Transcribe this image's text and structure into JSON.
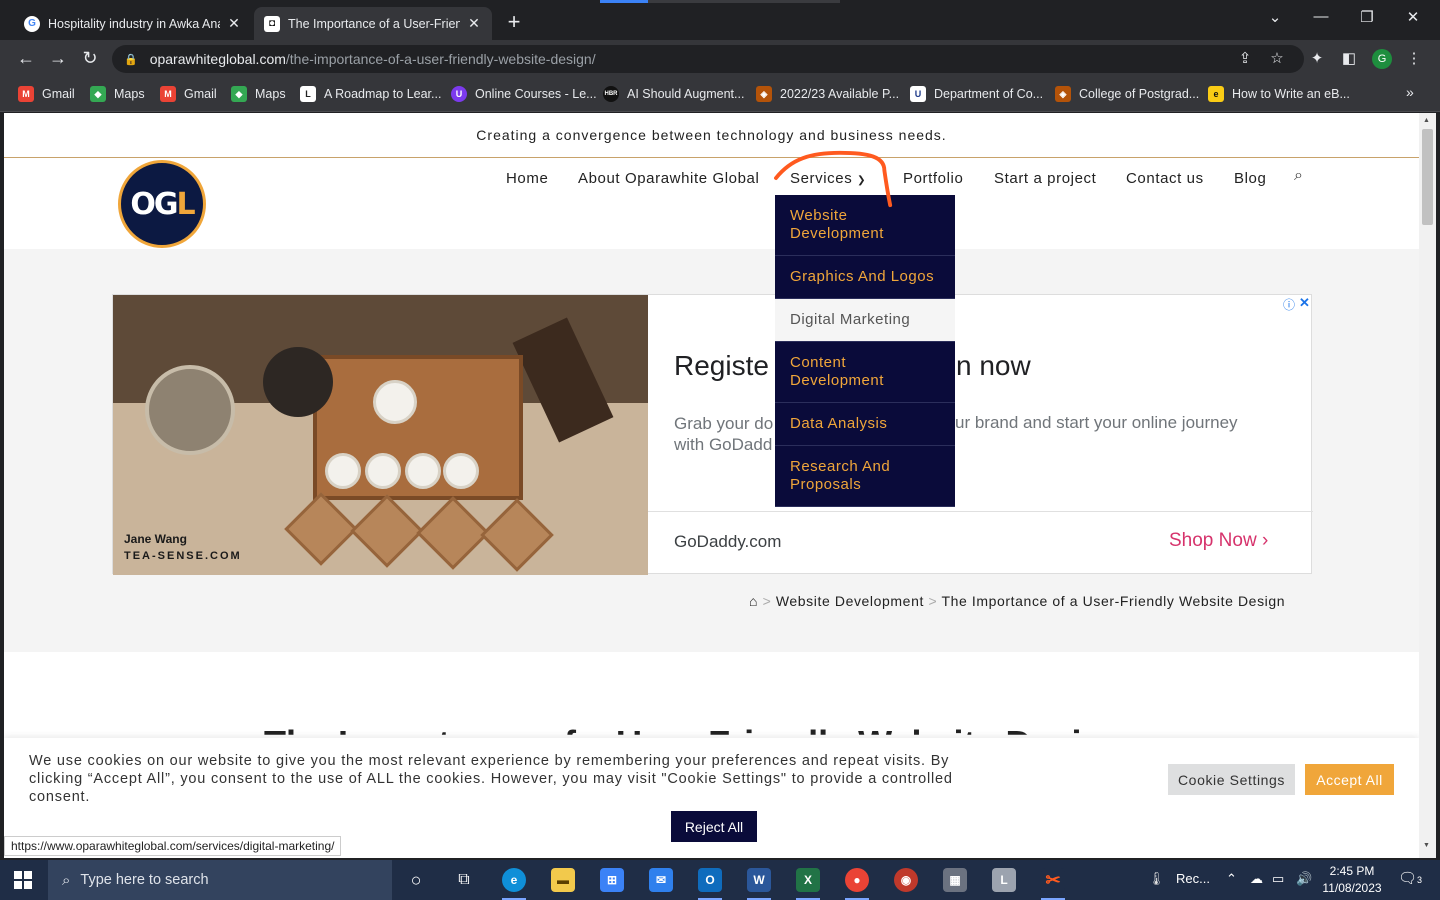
{
  "browser": {
    "tabs": [
      {
        "title": "Hospitality industry in Awka Anambra",
        "favicon": "google-icon"
      },
      {
        "title": "The Importance of a User-Friendly Website Design",
        "favicon": "site-icon"
      }
    ],
    "url_host": "oparawhiteglobal.com",
    "url_path": "/the-importance-of-a-user-friendly-website-design/",
    "bookmarks": [
      "Gmail",
      "Maps",
      "Gmail",
      "Maps",
      "A Roadmap to Lear...",
      "Online Courses - Le...",
      "AI Should Augment...",
      "2022/23 Available P...",
      "Department of Co...",
      "College of Postgrad...",
      "How to Write an eB..."
    ],
    "profile_initial": "G"
  },
  "site": {
    "tagline": "Creating a convergence between technology and business needs.",
    "logo_text": "OGL",
    "nav": [
      "Home",
      "About Oparawhite Global",
      "Services",
      "Portfolio",
      "Start a project",
      "Contact us",
      "Blog"
    ],
    "services_menu": [
      "Website Development",
      "Graphics And Logos",
      "Digital Marketing",
      "Content Development",
      "Data Analysis",
      "Research And Proposals"
    ],
    "hovered_service": "Digital Marketing",
    "breadcrumbs": [
      "Website Development",
      "The Importance of a User-Friendly Website Design"
    ],
    "headline_partial": "The Importance of a User-Friendly Website Design",
    "accent_color": "#f0a63a",
    "navy_color": "#0a0b3a"
  },
  "ad": {
    "headline_left": "Registe",
    "headline_right": "n now",
    "body_left": "Grab your do",
    "body_left2": "with GoDadd",
    "body_right": "ur brand and start your online journey",
    "image_caption_1": "Jane Wang",
    "image_caption_2": "TEA-SENSE.COM",
    "domain": "GoDaddy.com",
    "cta": "Shop Now"
  },
  "cookie": {
    "text": "We use cookies on our website to give you the most relevant experience by remembering your preferences and repeat visits. By clicking “Accept All”, you consent to the use of ALL the cookies. However, you may visit \"Cookie Settings\" to provide a controlled consent.",
    "settings_label": "Cookie Settings",
    "accept_label": "Accept All",
    "reject_label": "Reject All"
  },
  "status_url": "https://www.oparawhiteglobal.com/services/digital-marketing/",
  "taskbar": {
    "search_placeholder": "Type here to search",
    "tray_text": "Rec...",
    "time": "2:45 PM",
    "date": "11/08/2023",
    "notification_count": "3"
  }
}
